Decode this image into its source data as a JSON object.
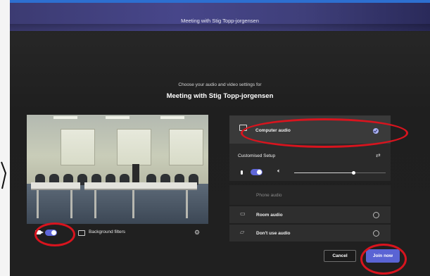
{
  "window": {
    "title": "Meeting with Stig Topp-jorgensen"
  },
  "prejoin": {
    "subtitle": "Choose your audio and video settings for",
    "meeting_title": "Meeting with Stig Topp-jorgensen"
  },
  "video": {
    "camera_on": true,
    "background_filters_label": "Background filters"
  },
  "audio": {
    "computer_audio_label": "Computer audio",
    "customised_setup_label": "Customised Setup",
    "mic_on": true,
    "volume_level": 0.65,
    "phone_audio_label": "Phone audio",
    "room_audio_label": "Room audio",
    "no_audio_label": "Don't use audio"
  },
  "actions": {
    "cancel_label": "Cancel",
    "join_label": "Join now"
  },
  "colors": {
    "accent": "#5a64d4",
    "annotation": "#d8141e",
    "titlebar": "#46468a"
  }
}
